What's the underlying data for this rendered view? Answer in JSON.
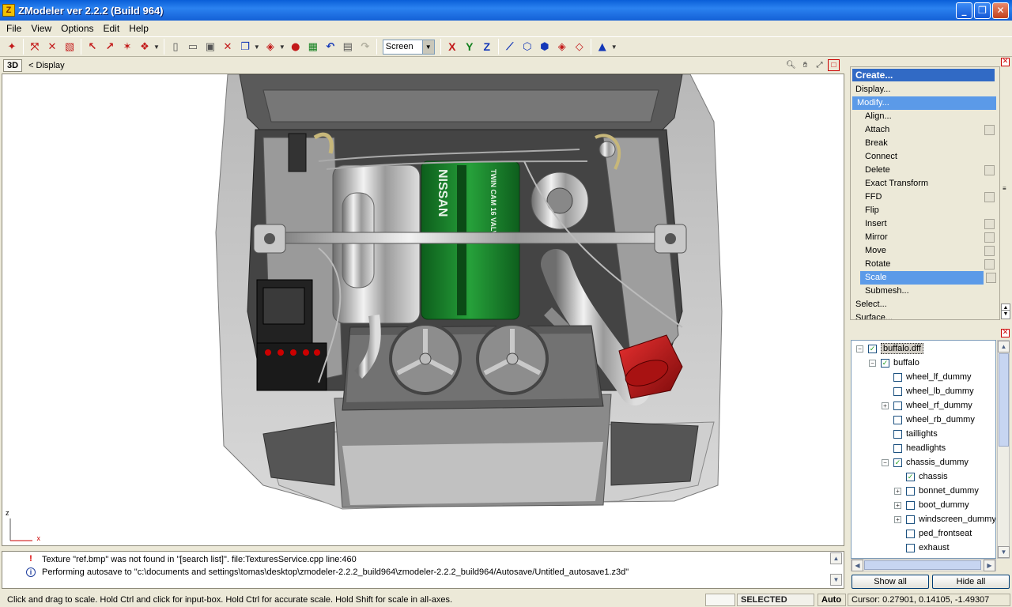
{
  "window": {
    "title": "ZModeler ver 2.2.2 (Build 964)",
    "icon_letter": "Z",
    "buttons": [
      "minimize-icon",
      "maximize-icon",
      "close-icon"
    ]
  },
  "menu": [
    "File",
    "View",
    "Options",
    "Edit",
    "Help"
  ],
  "toolbar": {
    "screen_select": "Screen",
    "axis_x": "X",
    "axis_y": "Y",
    "axis_z": "Z"
  },
  "viewport": {
    "mode": "3D",
    "title": "< Display",
    "gizmo_z": "z",
    "gizmo_x": "x",
    "engine_brand": "NISSAN",
    "engine_cam_text": "TWIN CAM 16 VALVE"
  },
  "command_panel": {
    "items": [
      {
        "label": "Create...",
        "type": "head"
      },
      {
        "label": "Display...",
        "type": "top"
      },
      {
        "label": "Modify...",
        "type": "modify"
      },
      {
        "label": "Align...",
        "type": "sub",
        "box": false
      },
      {
        "label": "Attach",
        "type": "sub",
        "box": true
      },
      {
        "label": "Break",
        "type": "sub",
        "box": false
      },
      {
        "label": "Connect",
        "type": "sub",
        "box": false
      },
      {
        "label": "Delete",
        "type": "sub",
        "box": true
      },
      {
        "label": "Exact Transform",
        "type": "sub",
        "box": false
      },
      {
        "label": "FFD",
        "type": "sub",
        "box": true
      },
      {
        "label": "Flip",
        "type": "sub",
        "box": false
      },
      {
        "label": "Insert",
        "type": "sub",
        "box": true
      },
      {
        "label": "Mirror",
        "type": "sub",
        "box": true
      },
      {
        "label": "Move",
        "type": "sub",
        "box": true
      },
      {
        "label": "Rotate",
        "type": "sub",
        "box": true
      },
      {
        "label": "Scale",
        "type": "active",
        "box": true
      },
      {
        "label": "Submesh...",
        "type": "sub",
        "box": false
      },
      {
        "label": "Select...",
        "type": "top"
      },
      {
        "label": "Surface...",
        "type": "top"
      }
    ]
  },
  "tree": {
    "rows": [
      {
        "label": "buffalo.dff",
        "depth": 0,
        "expander": "−",
        "checked": true,
        "selected": true
      },
      {
        "label": "buffalo",
        "depth": 1,
        "expander": "−",
        "checked": true
      },
      {
        "label": "wheel_lf_dummy",
        "depth": 2,
        "expander": "",
        "checked": false
      },
      {
        "label": "wheel_lb_dummy",
        "depth": 2,
        "expander": "",
        "checked": false
      },
      {
        "label": "wheel_rf_dummy",
        "depth": 2,
        "expander": "+",
        "checked": false
      },
      {
        "label": "wheel_rb_dummy",
        "depth": 2,
        "expander": "",
        "checked": false
      },
      {
        "label": "taillights",
        "depth": 2,
        "expander": "",
        "checked": false
      },
      {
        "label": "headlights",
        "depth": 2,
        "expander": "",
        "checked": false
      },
      {
        "label": "chassis_dummy",
        "depth": 2,
        "expander": "−",
        "checked": true
      },
      {
        "label": "chassis",
        "depth": 3,
        "expander": "",
        "checked": true
      },
      {
        "label": "bonnet_dummy",
        "depth": 3,
        "expander": "+",
        "checked": false
      },
      {
        "label": "boot_dummy",
        "depth": 3,
        "expander": "+",
        "checked": false
      },
      {
        "label": "windscreen_dummy",
        "depth": 3,
        "expander": "+",
        "checked": false
      },
      {
        "label": "ped_frontseat",
        "depth": 3,
        "expander": "",
        "checked": false
      },
      {
        "label": "exhaust",
        "depth": 3,
        "expander": "",
        "checked": false
      }
    ],
    "show_all": "Show all",
    "hide_all": "Hide all"
  },
  "log": [
    {
      "type": "warning",
      "icon": "!",
      "text": "Texture \"ref.bmp\" was not found in \"[search list]\". file:TexturesService.cpp line:460"
    },
    {
      "type": "info",
      "icon": "i",
      "text": "Performing autosave to \"c:\\documents and settings\\tomas\\desktop\\zmodeler-2.2.2_build964\\zmodeler-2.2.2_build964/Autosave/Untitled_autosave1.z3d\""
    }
  ],
  "status": {
    "hint": "Click and drag to scale. Hold Ctrl and click for input-box. Hold Ctrl for accurate scale. Hold Shift for scale in all-axes.",
    "mode": "SELECTED MODE",
    "auto": "Auto",
    "cursor": "Cursor: 0.27901, 0.14105, -1.49307"
  },
  "colors": {
    "titlebar": "#1460d6",
    "selection": "#316ac5",
    "engine_green": "#1e8a2e",
    "intake_red": "#c01818"
  }
}
